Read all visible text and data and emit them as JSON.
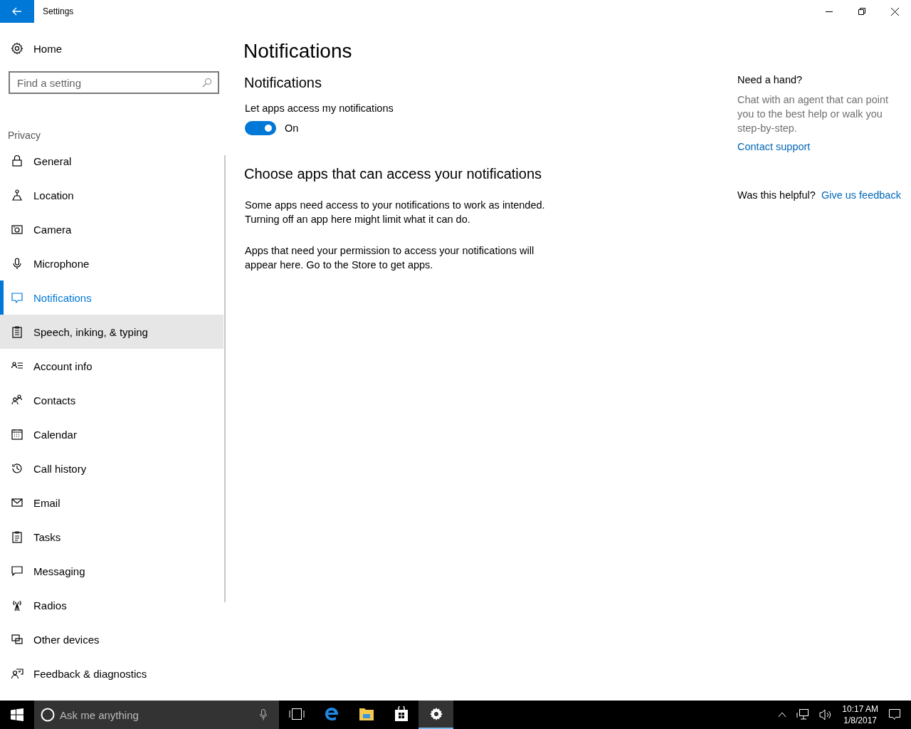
{
  "window": {
    "title": "Settings"
  },
  "sidebar": {
    "home": "Home",
    "search": {
      "placeholder": "Find a setting"
    },
    "section": "Privacy",
    "items": [
      {
        "label": "General",
        "selected": false,
        "hovered": false
      },
      {
        "label": "Location",
        "selected": false,
        "hovered": false
      },
      {
        "label": "Camera",
        "selected": false,
        "hovered": false
      },
      {
        "label": "Microphone",
        "selected": false,
        "hovered": false
      },
      {
        "label": "Notifications",
        "selected": true,
        "hovered": false
      },
      {
        "label": "Speech, inking, & typing",
        "selected": false,
        "hovered": true
      },
      {
        "label": "Account info",
        "selected": false,
        "hovered": false
      },
      {
        "label": "Contacts",
        "selected": false,
        "hovered": false
      },
      {
        "label": "Calendar",
        "selected": false,
        "hovered": false
      },
      {
        "label": "Call history",
        "selected": false,
        "hovered": false
      },
      {
        "label": "Email",
        "selected": false,
        "hovered": false
      },
      {
        "label": "Tasks",
        "selected": false,
        "hovered": false
      },
      {
        "label": "Messaging",
        "selected": false,
        "hovered": false
      },
      {
        "label": "Radios",
        "selected": false,
        "hovered": false
      },
      {
        "label": "Other devices",
        "selected": false,
        "hovered": false
      },
      {
        "label": "Feedback & diagnostics",
        "selected": false,
        "hovered": false
      }
    ]
  },
  "content": {
    "title": "Notifications",
    "section": "Notifications",
    "toggle": {
      "label": "Let apps access my notifications",
      "on": true,
      "state_text": "On"
    },
    "apps_heading": "Choose apps that can access your notifications",
    "paragraphs": [
      "Some apps need access to your notifications to work as intended. Turning off an app here might limit what it can do.",
      "Apps that need your permission to access your notifications will appear here. Go to the Store to get apps."
    ]
  },
  "help": {
    "title": "Need a hand?",
    "text": "Chat with an agent that can point you to the best help or walk you step-by-step.",
    "link": "Contact support",
    "helpful": "Was this helpful?",
    "feedback": "Give us feedback"
  },
  "taskbar": {
    "search": {
      "placeholder": "Ask me anything"
    },
    "apps": [
      {
        "active": false
      },
      {
        "active": false
      },
      {
        "active": false
      },
      {
        "active": false
      },
      {
        "active": true
      }
    ],
    "time": "10:17 AM",
    "date": "1/8/2017"
  }
}
